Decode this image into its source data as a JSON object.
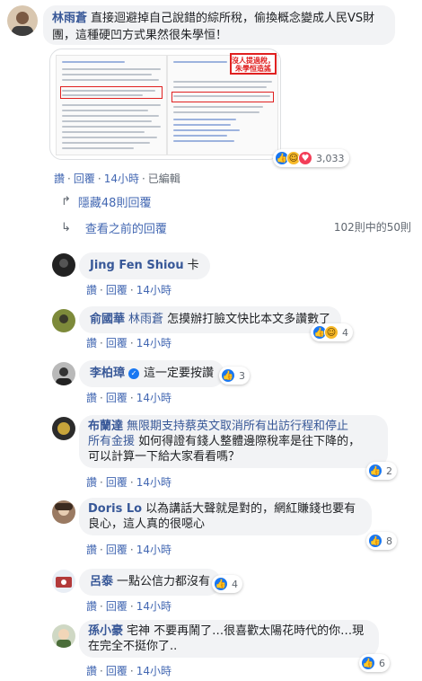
{
  "post": {
    "author": "林雨蒼",
    "text": "直接迴避掉自己說錯的綜所稅，偷換概念變成人民VS財團，這種硬凹方式果然很朱學恒！",
    "shot_sticker": "沒人提過稅，朱學恒造謠",
    "reactions_count": "3,033",
    "actions": {
      "like": "讚",
      "reply": "回覆",
      "time": "14小時",
      "edited": "已編輯"
    }
  },
  "hidden_replies": "隱藏48則回覆",
  "view_previous": "查看之前的回覆",
  "pagination": "102則中的50則",
  "replies": [
    {
      "name": "Jing Fen Shiou",
      "text": "卡",
      "like": "讚",
      "reply": "回覆",
      "time": "14小時",
      "reactions": ""
    },
    {
      "name": "俞國華",
      "tag": "林雨蒼",
      "text": "怎摸辦打臉文快比本文多讚數了",
      "like": "讚",
      "reply": "回覆",
      "time": "14小時",
      "reactions": "4"
    },
    {
      "name": "李柏璋",
      "text": "這一定要按讚",
      "like": "讚",
      "reply": "回覆",
      "time": "14小時",
      "reactions": "3"
    },
    {
      "name": "布蘭達",
      "text_line1": "無限期支持蔡英文取消所有出訪行程和停止",
      "text_line2": "所有金援",
      "text_rest1": "如何得證有錢人整體邊際稅率是往下降的，",
      "text_rest2": "可以計算一下給大家看看嗎？",
      "like": "讚",
      "reply": "回覆",
      "time": "14小時",
      "reactions": "2"
    },
    {
      "name": "Doris Lo",
      "text1": "以為講話大聲就是對的，網紅賺錢也要有",
      "text2": "良心，這人真的很噁心",
      "like": "讚",
      "reply": "回覆",
      "time": "14小時",
      "reactions": "8"
    },
    {
      "name": "呂泰",
      "text": "一點公信力都沒有",
      "like": "讚",
      "reply": "回覆",
      "time": "14小時",
      "reactions": "4"
    },
    {
      "name": "孫小豪",
      "text1": "宅神 不要再鬧了…很喜歡太陽花時代的你…現",
      "text2": "在完全不挺你了..",
      "like": "讚",
      "reply": "回覆",
      "time": "14小時",
      "reactions": "6"
    }
  ],
  "colors": {
    "link": "#4267b2",
    "name": "#385898",
    "bubble": "#f2f3f5"
  }
}
